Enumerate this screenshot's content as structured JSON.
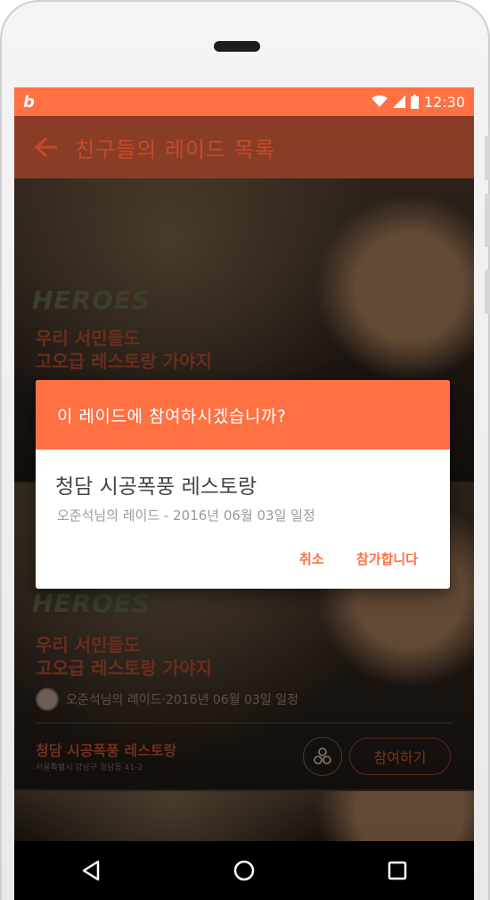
{
  "statusbar": {
    "time": "12:30",
    "app_logo": "b"
  },
  "toolbar": {
    "title": "친구들의 레이드 목록",
    "back_icon": "arrow-left-icon"
  },
  "cards": [
    {
      "logo": "HEROES",
      "title_line1": "우리 서민들도",
      "title_line2": "고오급 레스토랑 가야지"
    },
    {
      "logo": "HEROES",
      "title_line1": "우리 서민들도",
      "title_line2": "고오급 레스토랑 가야지",
      "meta": "오준석님의 레이드·2016년 06월 03일 일정",
      "place": "청담 시공폭풍 레스토랑",
      "address": "서울특별시 강남구 청담동 41-2",
      "join_label": "참여하기"
    }
  ],
  "dialog": {
    "title": "이 레이드에 참여하시겠습니까?",
    "place": "청담 시공폭풍 레스토랑",
    "subtitle": "오준석님의 레이드 - 2016년 06월 03일 일정",
    "cancel_label": "취소",
    "confirm_label": "참가합니다"
  },
  "colors": {
    "accent": "#ff7043"
  }
}
